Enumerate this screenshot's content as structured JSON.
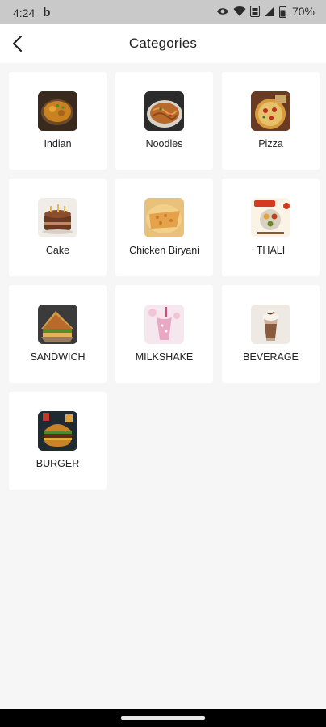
{
  "status_bar": {
    "time": "4:24",
    "app_indicator": "b",
    "battery": "70%",
    "icons": [
      "eye-icon",
      "wifi-icon",
      "volte-icon",
      "signal-icon",
      "battery-icon"
    ]
  },
  "header": {
    "title": "Categories",
    "back_icon": "back-arrow-icon"
  },
  "categories": [
    {
      "label": "Indian",
      "image": "indian-curry-photo"
    },
    {
      "label": "Noodles",
      "image": "noodles-photo"
    },
    {
      "label": "Pizza",
      "image": "pizza-photo"
    },
    {
      "label": "Cake",
      "image": "cake-photo"
    },
    {
      "label": "Chicken Biryani",
      "image": "chicken-biryani-photo"
    },
    {
      "label": "THALI",
      "image": "thali-poster-photo"
    },
    {
      "label": "SANDWICH",
      "image": "sandwich-photo"
    },
    {
      "label": "MILKSHAKE",
      "image": "milkshake-photo"
    },
    {
      "label": "BEVERAGE",
      "image": "beverage-photo"
    },
    {
      "label": "BURGER",
      "image": "burger-photo"
    }
  ],
  "colors": {
    "background": "#f6f6f6",
    "card": "#ffffff",
    "status_bar": "#c9c9c9",
    "nav_bar": "#000000"
  }
}
